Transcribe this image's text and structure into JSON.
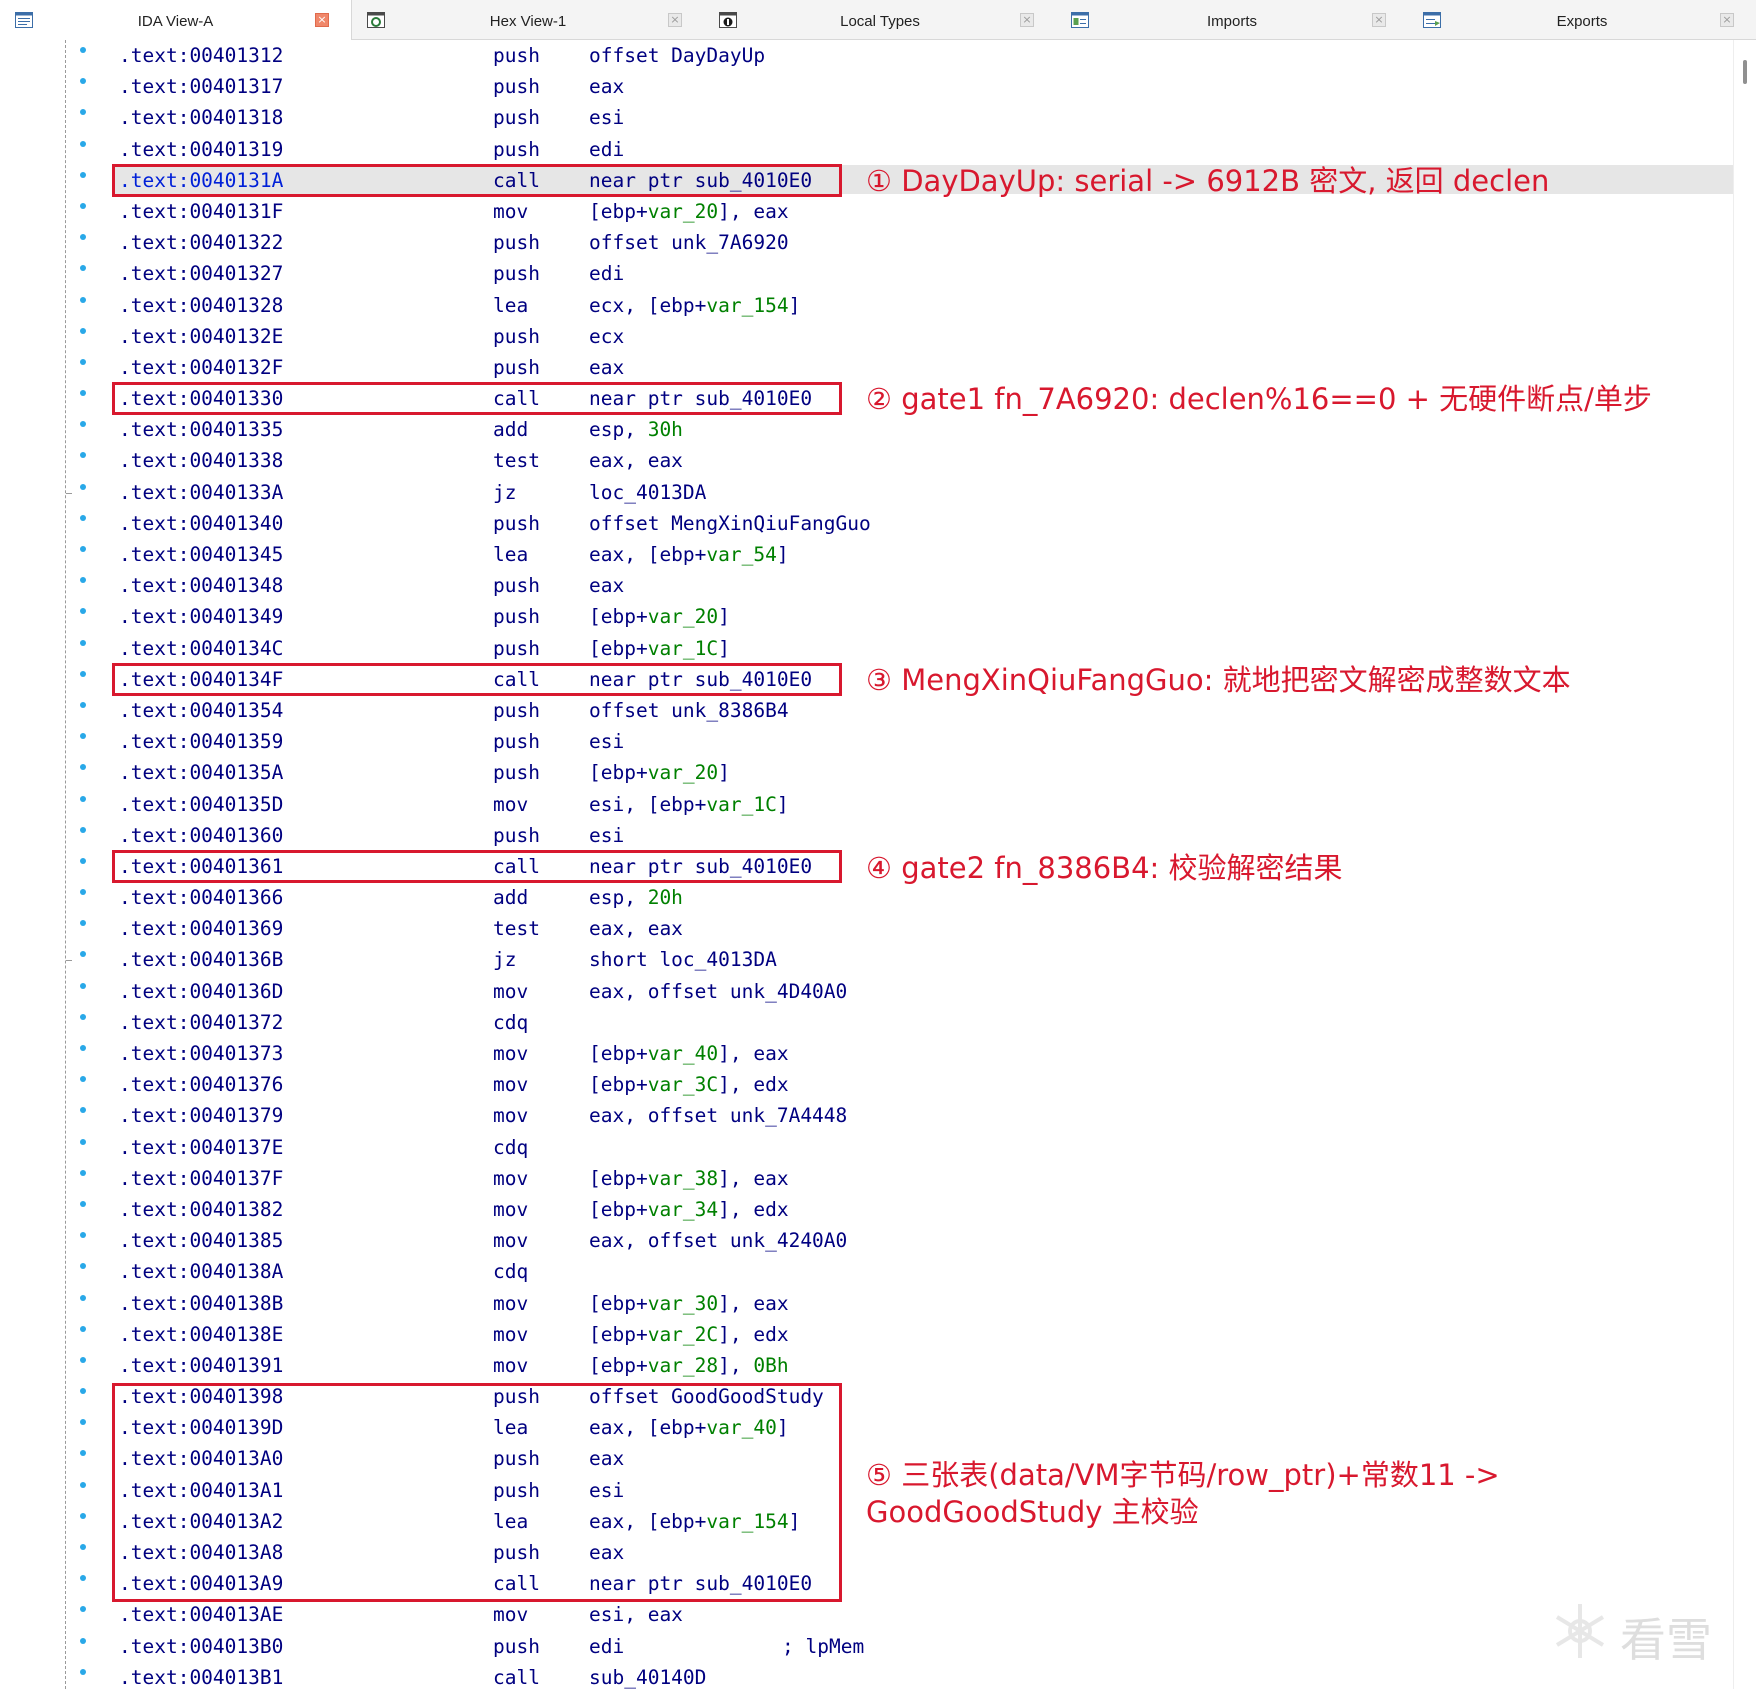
{
  "tabs": [
    {
      "label": "IDA View-A",
      "icon": "text-view-icon",
      "active": true
    },
    {
      "label": "Hex View-1",
      "icon": "hex-view-icon",
      "active": false
    },
    {
      "label": "Local Types",
      "icon": "local-types-icon",
      "active": false
    },
    {
      "label": "Imports",
      "icon": "imports-icon",
      "active": false
    },
    {
      "label": "Exports",
      "icon": "exports-icon",
      "active": false
    }
  ],
  "tab_close_glyph": "×",
  "listing": [
    {
      "addr": ".text:00401312",
      "mn": "push",
      "op": [
        [
          "offset DayDayUp",
          ""
        ]
      ]
    },
    {
      "addr": ".text:00401317",
      "mn": "push",
      "op": [
        [
          "eax",
          ""
        ]
      ]
    },
    {
      "addr": ".text:00401318",
      "mn": "push",
      "op": [
        [
          "esi",
          ""
        ]
      ]
    },
    {
      "addr": ".text:00401319",
      "mn": "push",
      "op": [
        [
          "edi",
          ""
        ]
      ]
    },
    {
      "addr": ".text:0040131A",
      "mn": "call",
      "op": [
        [
          "near ptr sub_4010E0",
          ""
        ]
      ],
      "selected": true
    },
    {
      "addr": ".text:0040131F",
      "mn": "mov",
      "op": [
        [
          "[ebp+",
          ""
        ],
        [
          "var_20",
          "var"
        ],
        [
          "], eax",
          ""
        ]
      ]
    },
    {
      "addr": ".text:00401322",
      "mn": "push",
      "op": [
        [
          "offset unk_7A6920",
          ""
        ]
      ]
    },
    {
      "addr": ".text:00401327",
      "mn": "push",
      "op": [
        [
          "edi",
          ""
        ]
      ]
    },
    {
      "addr": ".text:00401328",
      "mn": "lea",
      "op": [
        [
          "ecx, [ebp+",
          ""
        ],
        [
          "var_154",
          "var"
        ],
        [
          "]",
          ""
        ]
      ]
    },
    {
      "addr": ".text:0040132E",
      "mn": "push",
      "op": [
        [
          "ecx",
          ""
        ]
      ]
    },
    {
      "addr": ".text:0040132F",
      "mn": "push",
      "op": [
        [
          "eax",
          ""
        ]
      ]
    },
    {
      "addr": ".text:00401330",
      "mn": "call",
      "op": [
        [
          "near ptr sub_4010E0",
          ""
        ]
      ]
    },
    {
      "addr": ".text:00401335",
      "mn": "add",
      "op": [
        [
          "esp, ",
          ""
        ],
        [
          "30h",
          "var"
        ]
      ]
    },
    {
      "addr": ".text:00401338",
      "mn": "test",
      "op": [
        [
          "eax, eax",
          ""
        ]
      ]
    },
    {
      "addr": ".text:0040133A",
      "mn": "jz",
      "op": [
        [
          "loc_4013DA",
          ""
        ]
      ],
      "branch": true
    },
    {
      "addr": ".text:00401340",
      "mn": "push",
      "op": [
        [
          "offset MengXinQiuFangGuo",
          ""
        ]
      ]
    },
    {
      "addr": ".text:00401345",
      "mn": "lea",
      "op": [
        [
          "eax, [ebp+",
          ""
        ],
        [
          "var_54",
          "var"
        ],
        [
          "]",
          ""
        ]
      ]
    },
    {
      "addr": ".text:00401348",
      "mn": "push",
      "op": [
        [
          "eax",
          ""
        ]
      ]
    },
    {
      "addr": ".text:00401349",
      "mn": "push",
      "op": [
        [
          "[ebp+",
          ""
        ],
        [
          "var_20",
          "var"
        ],
        [
          "]",
          ""
        ]
      ]
    },
    {
      "addr": ".text:0040134C",
      "mn": "push",
      "op": [
        [
          "[ebp+",
          ""
        ],
        [
          "var_1C",
          "var"
        ],
        [
          "]",
          ""
        ]
      ]
    },
    {
      "addr": ".text:0040134F",
      "mn": "call",
      "op": [
        [
          "near ptr sub_4010E0",
          ""
        ]
      ]
    },
    {
      "addr": ".text:00401354",
      "mn": "push",
      "op": [
        [
          "offset unk_8386B4",
          ""
        ]
      ]
    },
    {
      "addr": ".text:00401359",
      "mn": "push",
      "op": [
        [
          "esi",
          ""
        ]
      ]
    },
    {
      "addr": ".text:0040135A",
      "mn": "push",
      "op": [
        [
          "[ebp+",
          ""
        ],
        [
          "var_20",
          "var"
        ],
        [
          "]",
          ""
        ]
      ]
    },
    {
      "addr": ".text:0040135D",
      "mn": "mov",
      "op": [
        [
          "esi, [ebp+",
          ""
        ],
        [
          "var_1C",
          "var"
        ],
        [
          "]",
          ""
        ]
      ]
    },
    {
      "addr": ".text:00401360",
      "mn": "push",
      "op": [
        [
          "esi",
          ""
        ]
      ]
    },
    {
      "addr": ".text:00401361",
      "mn": "call",
      "op": [
        [
          "near ptr sub_4010E0",
          ""
        ]
      ]
    },
    {
      "addr": ".text:00401366",
      "mn": "add",
      "op": [
        [
          "esp, ",
          ""
        ],
        [
          "20h",
          "var"
        ]
      ]
    },
    {
      "addr": ".text:00401369",
      "mn": "test",
      "op": [
        [
          "eax, eax",
          ""
        ]
      ]
    },
    {
      "addr": ".text:0040136B",
      "mn": "jz",
      "op": [
        [
          "short loc_4013DA",
          ""
        ]
      ],
      "branch": true
    },
    {
      "addr": ".text:0040136D",
      "mn": "mov",
      "op": [
        [
          "eax, offset unk_4D40A0",
          ""
        ]
      ]
    },
    {
      "addr": ".text:00401372",
      "mn": "cdq",
      "op": []
    },
    {
      "addr": ".text:00401373",
      "mn": "mov",
      "op": [
        [
          "[ebp+",
          ""
        ],
        [
          "var_40",
          "var"
        ],
        [
          "], eax",
          ""
        ]
      ]
    },
    {
      "addr": ".text:00401376",
      "mn": "mov",
      "op": [
        [
          "[ebp+",
          ""
        ],
        [
          "var_3C",
          "var"
        ],
        [
          "], edx",
          ""
        ]
      ]
    },
    {
      "addr": ".text:00401379",
      "mn": "mov",
      "op": [
        [
          "eax, offset unk_7A4448",
          ""
        ]
      ]
    },
    {
      "addr": ".text:0040137E",
      "mn": "cdq",
      "op": []
    },
    {
      "addr": ".text:0040137F",
      "mn": "mov",
      "op": [
        [
          "[ebp+",
          ""
        ],
        [
          "var_38",
          "var"
        ],
        [
          "], eax",
          ""
        ]
      ]
    },
    {
      "addr": ".text:00401382",
      "mn": "mov",
      "op": [
        [
          "[ebp+",
          ""
        ],
        [
          "var_34",
          "var"
        ],
        [
          "], edx",
          ""
        ]
      ]
    },
    {
      "addr": ".text:00401385",
      "mn": "mov",
      "op": [
        [
          "eax, offset unk_4240A0",
          ""
        ]
      ]
    },
    {
      "addr": ".text:0040138A",
      "mn": "cdq",
      "op": []
    },
    {
      "addr": ".text:0040138B",
      "mn": "mov",
      "op": [
        [
          "[ebp+",
          ""
        ],
        [
          "var_30",
          "var"
        ],
        [
          "], eax",
          ""
        ]
      ]
    },
    {
      "addr": ".text:0040138E",
      "mn": "mov",
      "op": [
        [
          "[ebp+",
          ""
        ],
        [
          "var_2C",
          "var"
        ],
        [
          "], edx",
          ""
        ]
      ]
    },
    {
      "addr": ".text:00401391",
      "mn": "mov",
      "op": [
        [
          "[ebp+",
          ""
        ],
        [
          "var_28",
          "var"
        ],
        [
          "], ",
          ""
        ],
        [
          "0Bh",
          "var"
        ]
      ]
    },
    {
      "addr": ".text:00401398",
      "mn": "push",
      "op": [
        [
          "offset GoodGoodStudy",
          ""
        ]
      ]
    },
    {
      "addr": ".text:0040139D",
      "mn": "lea",
      "op": [
        [
          "eax, [ebp+",
          ""
        ],
        [
          "var_40",
          "var"
        ],
        [
          "]",
          ""
        ]
      ]
    },
    {
      "addr": ".text:004013A0",
      "mn": "push",
      "op": [
        [
          "eax",
          ""
        ]
      ]
    },
    {
      "addr": ".text:004013A1",
      "mn": "push",
      "op": [
        [
          "esi",
          ""
        ]
      ]
    },
    {
      "addr": ".text:004013A2",
      "mn": "lea",
      "op": [
        [
          "eax, [ebp+",
          ""
        ],
        [
          "var_154",
          "var"
        ],
        [
          "]",
          ""
        ]
      ]
    },
    {
      "addr": ".text:004013A8",
      "mn": "push",
      "op": [
        [
          "eax",
          ""
        ]
      ]
    },
    {
      "addr": ".text:004013A9",
      "mn": "call",
      "op": [
        [
          "near ptr sub_4010E0",
          ""
        ]
      ]
    },
    {
      "addr": ".text:004013AE",
      "mn": "mov",
      "op": [
        [
          "esi, eax",
          ""
        ]
      ]
    },
    {
      "addr": ".text:004013B0",
      "mn": "push",
      "op": [
        [
          "edi",
          ""
        ]
      ],
      "comment": "; lpMem"
    },
    {
      "addr": ".text:004013B1",
      "mn": "call",
      "op": [
        [
          "sub_40140D",
          ""
        ]
      ]
    }
  ],
  "annotations": [
    {
      "text": "① DayDayUp: serial -> 6912B 密文, 返回 declen"
    },
    {
      "text": "② gate1 fn_7A6920: declen%16==0 + 无硬件断点/单步"
    },
    {
      "text": "③ MengXinQiuFangGuo: 就地把密文解密成整数文本"
    },
    {
      "text": "④ gate2 fn_8386B4: 校验解密结果"
    },
    {
      "text": "⑤ 三张表(data/VM字节码/row_ptr)+常数11 ->",
      "text2": "GoodGoodStudy 主校验"
    }
  ],
  "watermark": "看雪",
  "colors": {
    "code": "#000080",
    "variable": "#008000",
    "selected_address": "#0020d8",
    "annotation": "#d8182e",
    "gutter_dot": "#29a8e8",
    "current_line": "#e6e6e6"
  }
}
